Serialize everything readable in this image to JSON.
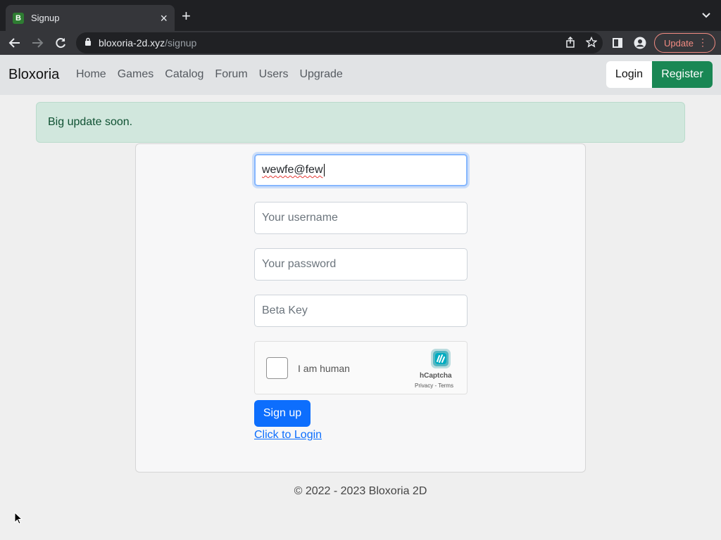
{
  "browser": {
    "tab_title": "Signup",
    "favicon_letter": "B",
    "url_host": "bloxoria-2d.xyz",
    "url_path": "/signup",
    "update_label": "Update"
  },
  "navbar": {
    "brand": "Bloxoria",
    "links": [
      "Home",
      "Games",
      "Catalog",
      "Forum",
      "Users",
      "Upgrade"
    ],
    "login_label": "Login",
    "register_label": "Register"
  },
  "alert": {
    "text": "Big update soon."
  },
  "form": {
    "email_value": "wewfe@few",
    "username_placeholder": "Your username",
    "password_placeholder": "Your password",
    "beta_placeholder": "Beta Key",
    "captcha_label": "I am human",
    "captcha_brand": "hCaptcha",
    "captcha_links": "Privacy - Terms",
    "submit_label": "Sign up",
    "login_link": "Click to Login"
  },
  "footer": {
    "text": "© 2022 - 2023 Bloxoria 2D"
  },
  "colors": {
    "primary": "#0d6efd",
    "success": "#198754",
    "alert_bg": "#d1e7dd"
  }
}
